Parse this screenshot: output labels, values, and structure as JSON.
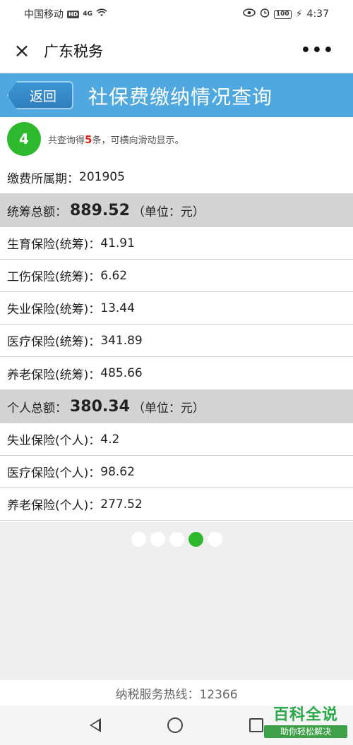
{
  "statusbar": {
    "carrier": "中国移动",
    "hd": "HD",
    "signal": "4G",
    "battery": "100",
    "time": "4:37"
  },
  "header": {
    "close_icon": "×",
    "title": "广东税务",
    "more_icon": "•••"
  },
  "banner": {
    "back_label": "返回",
    "title": "社保费缴纳情况查询"
  },
  "result": {
    "index": "4",
    "text_prefix": "共查询得",
    "count": "5",
    "text_suffix": "条，可横向滑动显示。"
  },
  "period": {
    "label": "缴费所属期：",
    "value": "201905"
  },
  "pooled": {
    "label": "统筹总额：",
    "amount": "889.52",
    "unit": "（单位：元）",
    "items": [
      {
        "label": "生育保险(统筹)：",
        "value": "41.91"
      },
      {
        "label": "工伤保险(统筹)：",
        "value": "6.62"
      },
      {
        "label": "失业保险(统筹)：",
        "value": "13.44"
      },
      {
        "label": "医疗保险(统筹)：",
        "value": "341.89"
      },
      {
        "label": "养老保险(统筹)：",
        "value": "485.66"
      }
    ]
  },
  "personal": {
    "label": "个人总额：",
    "amount": "380.34",
    "unit": "（单位：元）",
    "items": [
      {
        "label": "失业保险(个人)：",
        "value": "4.2"
      },
      {
        "label": "医疗保险(个人)：",
        "value": "98.62"
      },
      {
        "label": "养老保险(个人)：",
        "value": "277.52"
      }
    ]
  },
  "pager": {
    "total": 5,
    "active": 4
  },
  "footer": {
    "hotline": "纳税服务热线：12366"
  },
  "watermark": {
    "main": "百科全说",
    "sub": "助你轻松解决"
  },
  "colors": {
    "accent_green": "#2eb82e",
    "banner_blue": "#4fa8e0",
    "count_red": "#e02020"
  }
}
